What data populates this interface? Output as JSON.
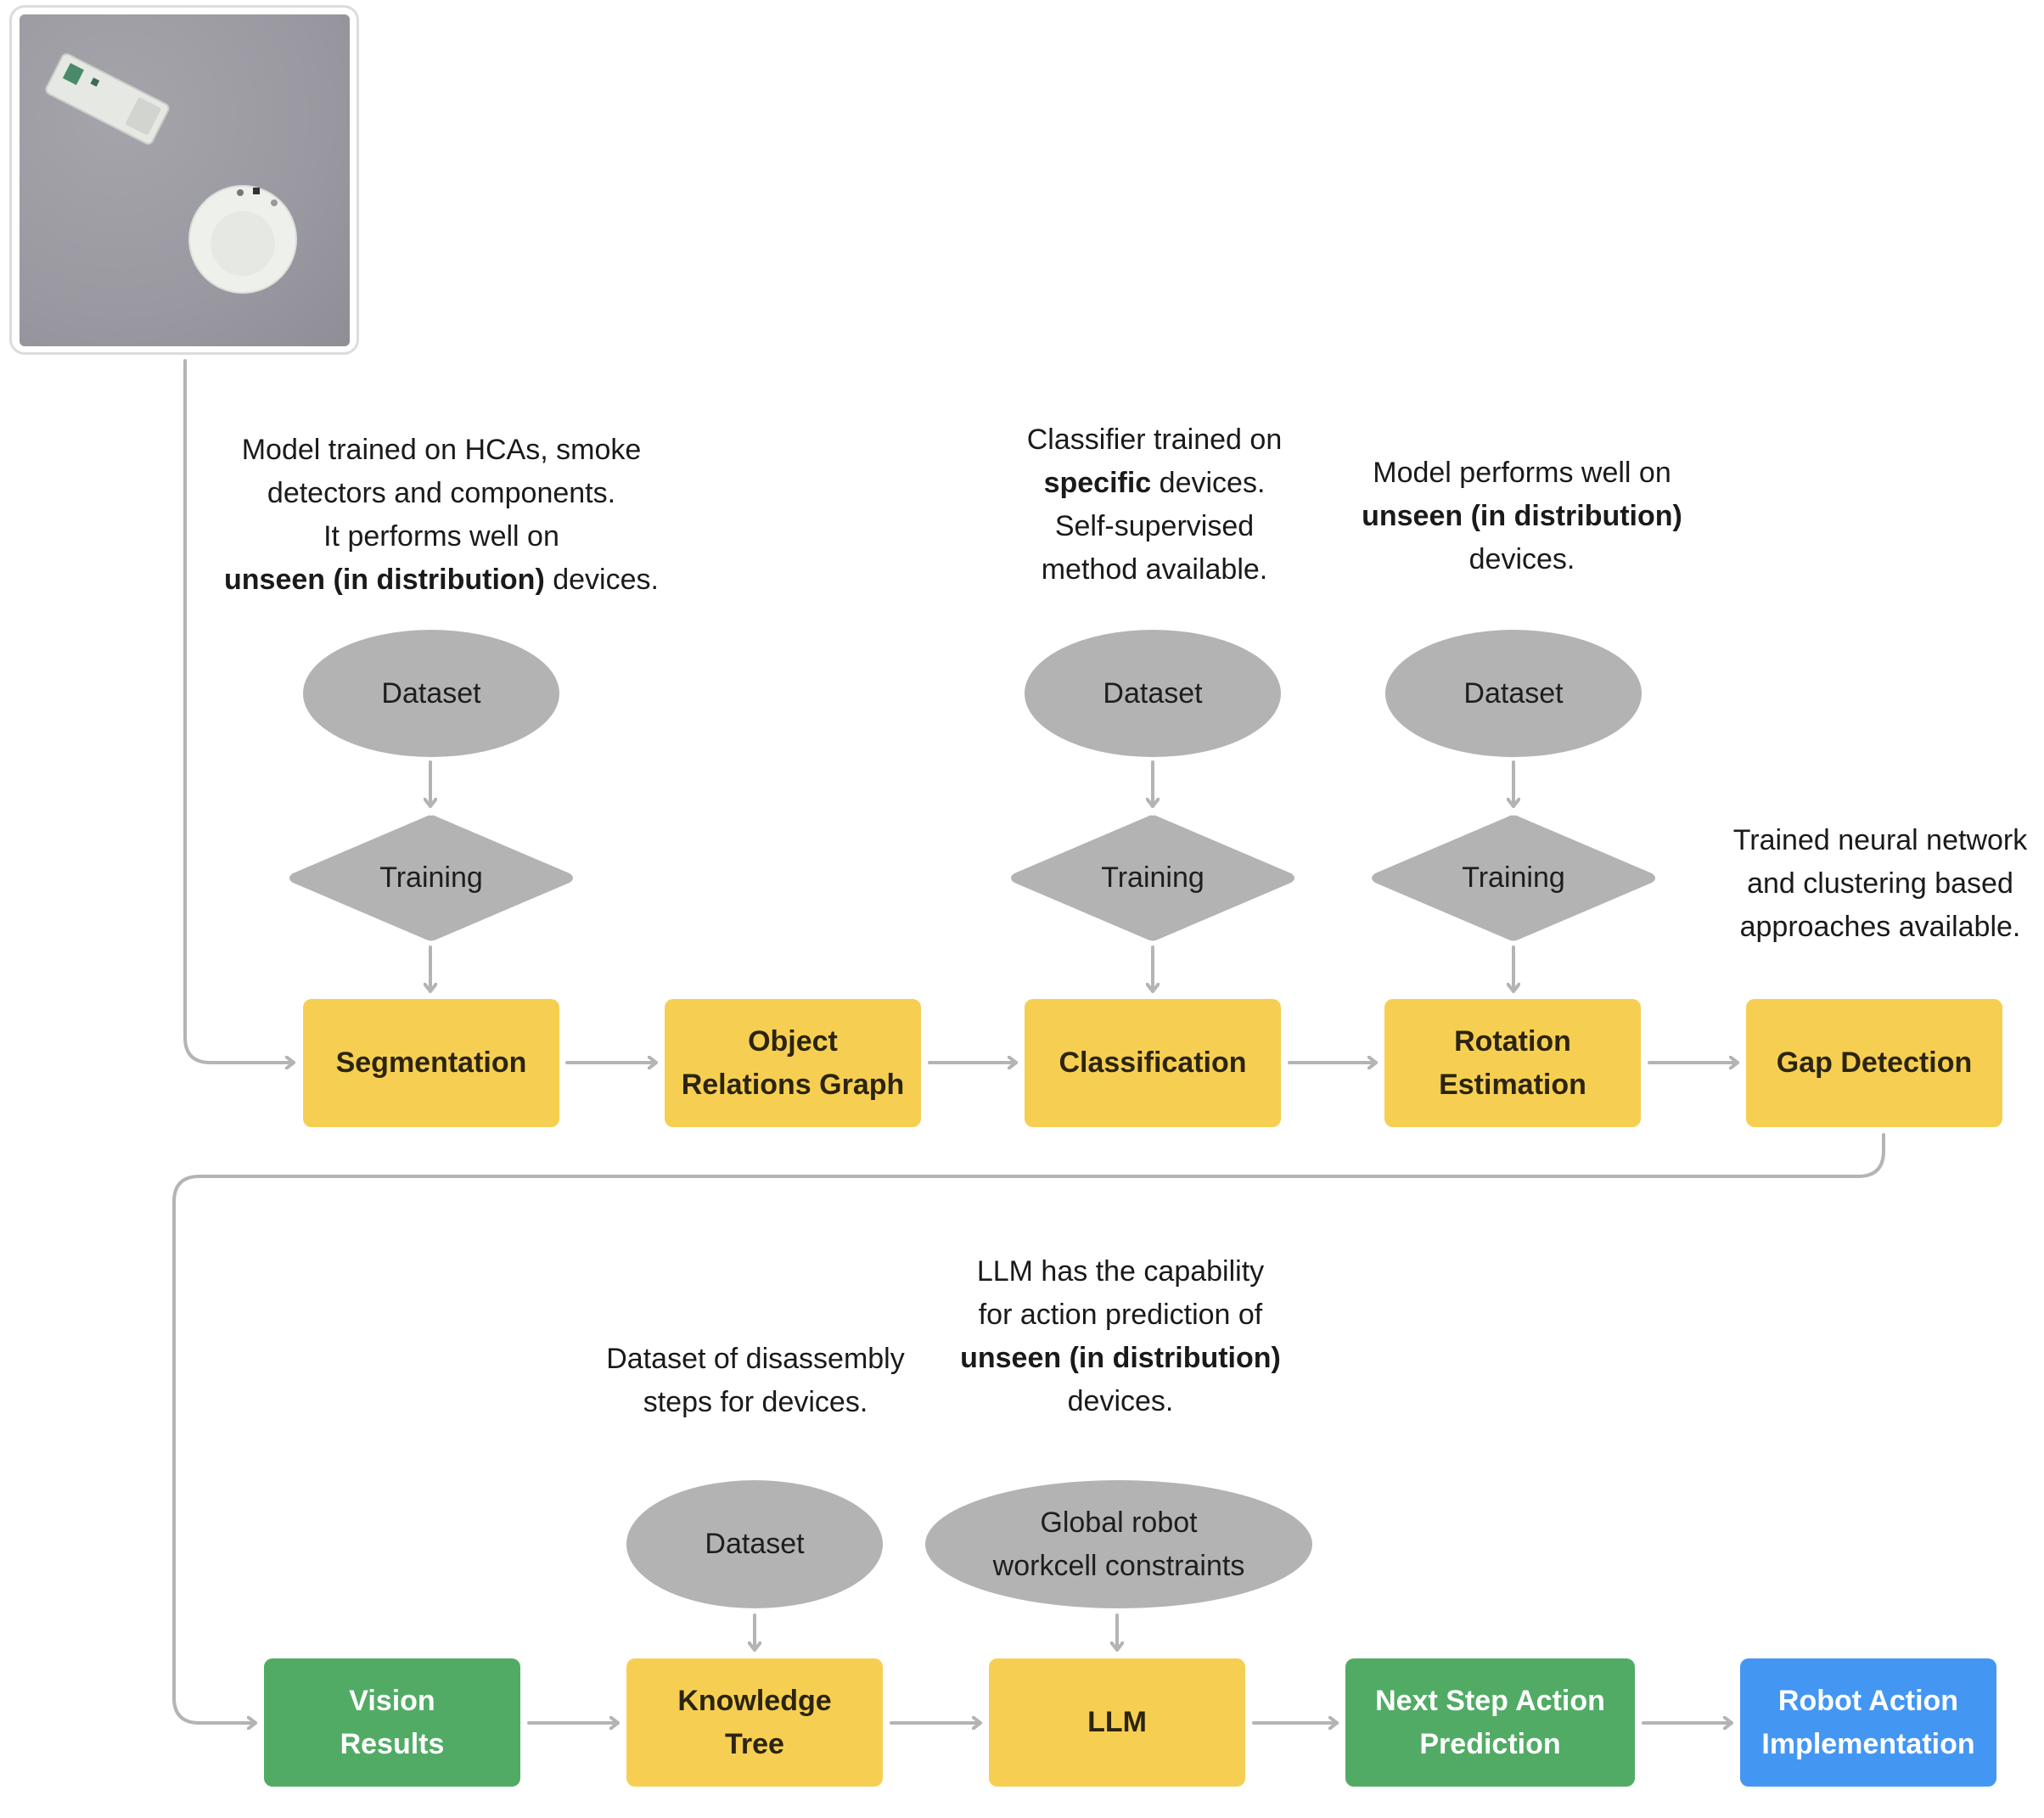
{
  "colors": {
    "process_box": "#f6cf52",
    "output_box": "#51ab65",
    "action_box": "#4496f3",
    "resource_shape": "#b3b3b3",
    "connector": "#b4b4b4"
  },
  "input_image": {
    "description": "Top-down photo of a disassembled smoke detector: opened rectangular casing with circuit board and round white detector body on grey surface"
  },
  "row1": {
    "notes": {
      "segmentation": {
        "line1": "Model trained on HCAs, smoke",
        "line2": "detectors and components.",
        "line3": "It performs well on",
        "line4_bold": "unseen (in distribution)",
        "line4_rest": " devices."
      },
      "classification": {
        "line1": "Classifier trained on",
        "line2_bold": "specific",
        "line2_rest": " devices.",
        "line3": "Self-supervised",
        "line4": "method available."
      },
      "rotation": {
        "line1": "Model performs well on",
        "line2_bold": "unseen (in distribution)",
        "line3": "devices."
      },
      "gap": {
        "line1": "Trained neural network",
        "line2": "and clustering based",
        "line3": "approaches available."
      }
    },
    "resources": {
      "dataset_label": "Dataset",
      "training_label": "Training"
    },
    "boxes": {
      "segmentation": "Segmentation",
      "object_relations_line1": "Object",
      "object_relations_line2": "Relations Graph",
      "classification": "Classification",
      "rotation_line1": "Rotation",
      "rotation_line2": "Estimation",
      "gap_detection": "Gap Detection"
    }
  },
  "row2": {
    "notes": {
      "knowledge": {
        "line1": "Dataset of disassembly",
        "line2": "steps for devices."
      },
      "llm": {
        "line1": "LLM has the capability",
        "line2": "for action prediction of",
        "line3_bold": "unseen (in distribution)",
        "line4": "devices."
      }
    },
    "resources": {
      "dataset_label": "Dataset",
      "constraints_line1": "Global robot",
      "constraints_line2": "workcell constraints"
    },
    "boxes": {
      "vision_line1": "Vision",
      "vision_line2": "Results",
      "knowledge_line1": "Knowledge",
      "knowledge_line2": "Tree",
      "llm": "LLM",
      "next_step_line1": "Next Step Action",
      "next_step_line2": "Prediction",
      "robot_line1": "Robot Action",
      "robot_line2": "Implementation"
    }
  }
}
